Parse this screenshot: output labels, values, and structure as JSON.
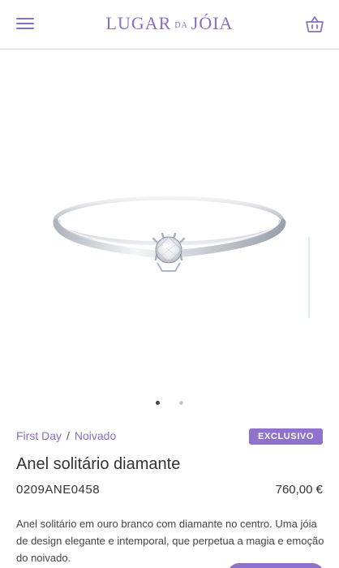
{
  "header": {
    "menu_icon": "hamburger-icon",
    "logo": {
      "main_left": "LUGAR",
      "middle": "DA",
      "main_right": "JÓIA"
    },
    "cart_icon": "shopping-basket-icon"
  },
  "gallery": {
    "image_alt": "ring-image",
    "dots_total": 2,
    "active_index": 0
  },
  "breadcrumb": {
    "items": [
      "First Day",
      "Noivado"
    ],
    "separator": "/"
  },
  "badge": {
    "label": "EXCLUSIVO"
  },
  "product": {
    "title": "Anel solitário diamante",
    "sku": "0209ANE0458",
    "price": "760,00 €",
    "description": "Anel solitário em ouro branco com diamante no centro. Uma jóia de design elegante e intemporal, que perpetua a magia e emoção do noivado."
  },
  "colors": {
    "accent": "#8a6fc4",
    "badge": "#8f72cc"
  }
}
